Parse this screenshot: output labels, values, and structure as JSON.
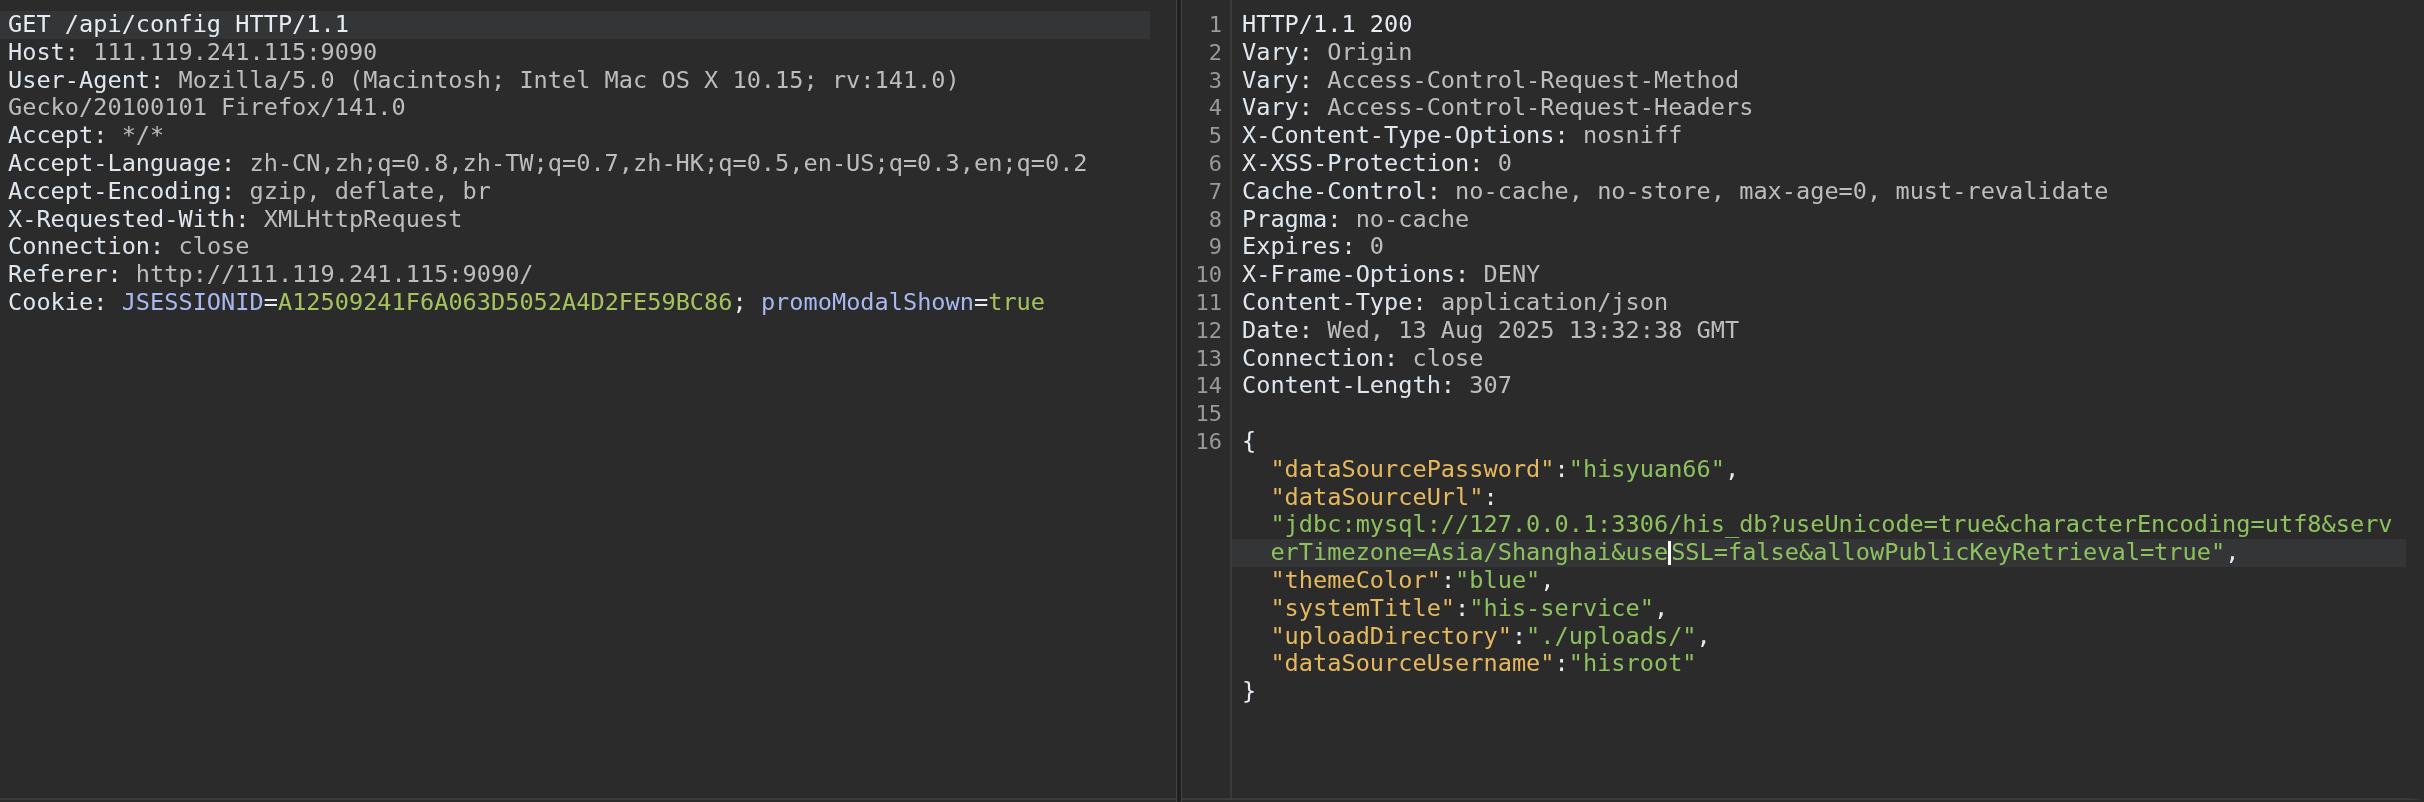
{
  "request": {
    "lines": [
      {
        "current": true,
        "segments": [
          {
            "kind": "plain",
            "text": "GET /api/config HTTP/1.1"
          }
        ]
      },
      {
        "current": false,
        "segments": [
          {
            "kind": "name",
            "text": "Host:"
          },
          {
            "kind": "value",
            "text": " 111.119.241.115:9090"
          }
        ]
      },
      {
        "current": false,
        "segments": [
          {
            "kind": "name",
            "text": "User-Agent:"
          },
          {
            "kind": "value",
            "text": " Mozilla/5.0 (Macintosh; Intel Mac OS X 10.15; rv:141.0)"
          }
        ]
      },
      {
        "current": false,
        "segments": [
          {
            "kind": "value",
            "text": "Gecko/20100101 Firefox/141.0"
          }
        ]
      },
      {
        "current": false,
        "segments": [
          {
            "kind": "name",
            "text": "Accept:"
          },
          {
            "kind": "value",
            "text": " */*"
          }
        ]
      },
      {
        "current": false,
        "segments": [
          {
            "kind": "name",
            "text": "Accept-Language:"
          },
          {
            "kind": "value",
            "text": " zh-CN,zh;q=0.8,zh-TW;q=0.7,zh-HK;q=0.5,en-US;q=0.3,en;q=0.2"
          }
        ]
      },
      {
        "current": false,
        "segments": [
          {
            "kind": "name",
            "text": "Accept-Encoding:"
          },
          {
            "kind": "value",
            "text": " gzip, deflate, br"
          }
        ]
      },
      {
        "current": false,
        "segments": [
          {
            "kind": "name",
            "text": "X-Requested-With:"
          },
          {
            "kind": "value",
            "text": " XMLHttpRequest"
          }
        ]
      },
      {
        "current": false,
        "segments": [
          {
            "kind": "name",
            "text": "Connection:"
          },
          {
            "kind": "value",
            "text": " close"
          }
        ]
      },
      {
        "current": false,
        "segments": [
          {
            "kind": "name",
            "text": "Referer:"
          },
          {
            "kind": "value",
            "text": " http://111.119.241.115:9090/"
          }
        ]
      },
      {
        "current": false,
        "segments": [
          {
            "kind": "name",
            "text": "Cookie:"
          },
          {
            "kind": "cookie_name",
            "text": " JSESSIONID"
          },
          {
            "kind": "plain",
            "text": "="
          },
          {
            "kind": "cookie_value",
            "text": "A12509241F6A063D5052A4D2FE59BC86"
          },
          {
            "kind": "plain",
            "text": ";"
          },
          {
            "kind": "cookie_name",
            "text": " promoModalShown"
          },
          {
            "kind": "plain",
            "text": "="
          },
          {
            "kind": "cookie_value",
            "text": "true"
          }
        ]
      }
    ]
  },
  "response": {
    "lines": [
      {
        "number": "1",
        "current": false,
        "segments": [
          {
            "kind": "plain",
            "text": "HTTP/1.1 200"
          }
        ]
      },
      {
        "number": "2",
        "current": false,
        "segments": [
          {
            "kind": "name",
            "text": "Vary:"
          },
          {
            "kind": "value",
            "text": " Origin"
          }
        ]
      },
      {
        "number": "3",
        "current": false,
        "segments": [
          {
            "kind": "name",
            "text": "Vary:"
          },
          {
            "kind": "value",
            "text": " Access-Control-Request-Method"
          }
        ]
      },
      {
        "number": "4",
        "current": false,
        "segments": [
          {
            "kind": "name",
            "text": "Vary:"
          },
          {
            "kind": "value",
            "text": " Access-Control-Request-Headers"
          }
        ]
      },
      {
        "number": "5",
        "current": false,
        "segments": [
          {
            "kind": "name",
            "text": "X-Content-Type-Options:"
          },
          {
            "kind": "value",
            "text": " nosniff"
          }
        ]
      },
      {
        "number": "6",
        "current": false,
        "segments": [
          {
            "kind": "name",
            "text": "X-XSS-Protection:"
          },
          {
            "kind": "value",
            "text": " 0"
          }
        ]
      },
      {
        "number": "7",
        "current": false,
        "segments": [
          {
            "kind": "name",
            "text": "Cache-Control:"
          },
          {
            "kind": "value",
            "text": " no-cache, no-store, max-age=0, must-revalidate"
          }
        ]
      },
      {
        "number": "8",
        "current": false,
        "segments": [
          {
            "kind": "name",
            "text": "Pragma:"
          },
          {
            "kind": "value",
            "text": " no-cache"
          }
        ]
      },
      {
        "number": "9",
        "current": false,
        "segments": [
          {
            "kind": "name",
            "text": "Expires:"
          },
          {
            "kind": "value",
            "text": " 0"
          }
        ]
      },
      {
        "number": "10",
        "current": false,
        "segments": [
          {
            "kind": "name",
            "text": "X-Frame-Options:"
          },
          {
            "kind": "value",
            "text": " DENY"
          }
        ]
      },
      {
        "number": "11",
        "current": false,
        "segments": [
          {
            "kind": "name",
            "text": "Content-Type:"
          },
          {
            "kind": "value",
            "text": " application/json"
          }
        ]
      },
      {
        "number": "12",
        "current": false,
        "segments": [
          {
            "kind": "name",
            "text": "Date:"
          },
          {
            "kind": "value",
            "text": " Wed, 13 Aug 2025 13:32:38 GMT"
          }
        ]
      },
      {
        "number": "13",
        "current": false,
        "segments": [
          {
            "kind": "name",
            "text": "Connection:"
          },
          {
            "kind": "value",
            "text": " close"
          }
        ]
      },
      {
        "number": "14",
        "current": false,
        "segments": [
          {
            "kind": "name",
            "text": "Content-Length:"
          },
          {
            "kind": "value",
            "text": " 307"
          }
        ]
      },
      {
        "number": "15",
        "current": false
      },
      {
        "number": "16",
        "current": false,
        "segments": [
          {
            "kind": "plain",
            "text": "{"
          }
        ]
      },
      {
        "current": false,
        "segments": [
          {
            "kind": "json_key",
            "text": "  \"dataSourcePassword\""
          },
          {
            "kind": "plain",
            "text": ":"
          },
          {
            "kind": "json_string",
            "text": "\"hisyuan66\""
          },
          {
            "kind": "plain",
            "text": ","
          }
        ]
      },
      {
        "current": false,
        "segments": [
          {
            "kind": "json_key",
            "text": "  \"dataSourceUrl\""
          },
          {
            "kind": "plain",
            "text": ":"
          }
        ]
      },
      {
        "current": false,
        "segments": [
          {
            "kind": "json_string",
            "text": "  \"jdbc:mysql://127.0.0.1:3306/his_db?useUnicode=true&characterEncoding=utf8&serv"
          }
        ]
      },
      {
        "current": true,
        "segments": [
          {
            "kind": "json_string",
            "text": "  erTimezone=Asia/Shanghai&use"
          },
          {
            "kind": "caret"
          },
          {
            "kind": "json_string",
            "text": "SSL=false&allowPublicKeyRetrieval=true\""
          },
          {
            "kind": "plain",
            "text": ","
          }
        ]
      },
      {
        "current": false,
        "segments": [
          {
            "kind": "json_key",
            "text": "  \"themeColor\""
          },
          {
            "kind": "plain",
            "text": ":"
          },
          {
            "kind": "json_string",
            "text": "\"blue\""
          },
          {
            "kind": "plain",
            "text": ","
          }
        ]
      },
      {
        "current": false,
        "segments": [
          {
            "kind": "json_key",
            "text": "  \"systemTitle\""
          },
          {
            "kind": "plain",
            "text": ":"
          },
          {
            "kind": "json_string",
            "text": "\"his-service\""
          },
          {
            "kind": "plain",
            "text": ","
          }
        ]
      },
      {
        "current": false,
        "segments": [
          {
            "kind": "json_key",
            "text": "  \"uploadDirectory\""
          },
          {
            "kind": "plain",
            "text": ":"
          },
          {
            "kind": "json_string",
            "text": "\"./uploads/\""
          },
          {
            "kind": "plain",
            "text": ","
          }
        ]
      },
      {
        "current": false,
        "segments": [
          {
            "kind": "json_key",
            "text": "  \"dataSourceUsername\""
          },
          {
            "kind": "plain",
            "text": ":"
          },
          {
            "kind": "json_string",
            "text": "\"hisroot\""
          }
        ]
      },
      {
        "current": false,
        "segments": [
          {
            "kind": "plain",
            "text": "}"
          }
        ]
      }
    ]
  }
}
